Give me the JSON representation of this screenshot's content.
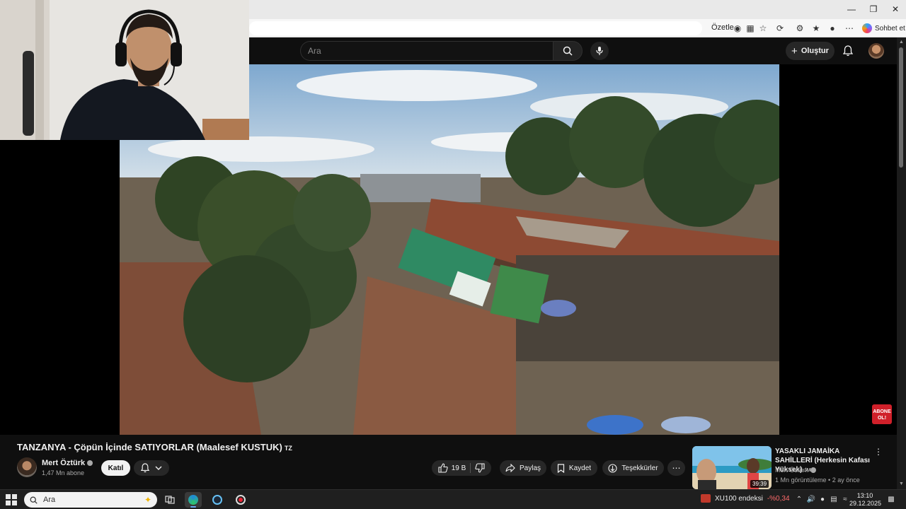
{
  "browser": {
    "summarize_label": "Özetle",
    "chat_label": "Sohbet et"
  },
  "masthead": {
    "search_placeholder": "Ara",
    "create_label": "Oluştur"
  },
  "video": {
    "title": "TANZANYA - Çöpün İçinde SATIYORLAR (Maalesef KUSTUK)",
    "title_flag": "TZ",
    "subscribe_badge_line1": "ABONE",
    "subscribe_badge_line2": "OL!"
  },
  "channel": {
    "name": "Mert Öztürk",
    "subscribers": "1,47 Mn abone",
    "join_label": "Katıl"
  },
  "actions": {
    "likes": "19 B",
    "share_label": "Paylaş",
    "save_label": "Kaydet",
    "thanks_label": "Teşekkürler"
  },
  "recommendation": {
    "title": "YASAKLI JAMAİKA SAHİLLERİ (Herkesin Kafası Yüksek)",
    "title_flag": "JM",
    "channel": "Mert Öztürk",
    "meta": "1 Mn görüntüleme • 2 ay önce",
    "duration": "39:39"
  },
  "taskbar": {
    "search_placeholder": "Ara",
    "stock_name": "XU100 endeksi",
    "stock_change": "-%0,34",
    "time": "13:10",
    "date": "29.12.2025"
  },
  "colors": {
    "youtube_dark": "#0f0f0f",
    "pill_bg": "#272727",
    "stock_negative": "#ff6b6b",
    "subscribe_red": "#d0202a"
  }
}
